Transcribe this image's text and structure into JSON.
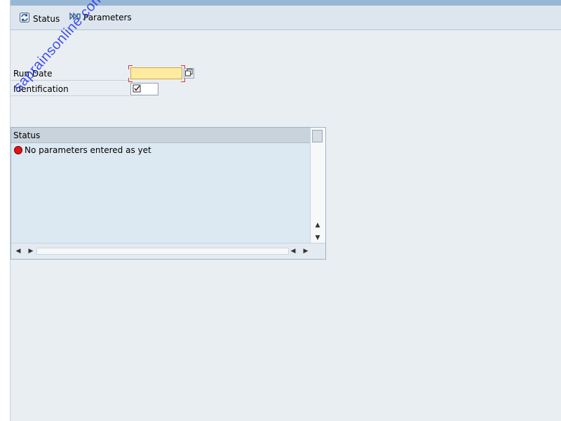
{
  "toolbar": {
    "status_label": "Status",
    "parameters_label": "Parameters",
    "status_icon": "refresh-status-icon",
    "parameters_icon": "parameters-icon"
  },
  "form": {
    "run_date_label": "Run Date",
    "run_date_value": "",
    "identification_label": "Identification",
    "identification_value": "",
    "input_help_icon": "value-help-icon"
  },
  "status_panel": {
    "header": "Status",
    "messages": [
      {
        "icon": "red-status-icon",
        "text": "No parameters entered as yet"
      }
    ]
  },
  "watermark": "saprainsonline.com",
  "colors": {
    "background": "#e9eef3",
    "toolbar": "#dde6ee",
    "required_field": "#ffeba0",
    "error_red": "#e01414",
    "watermark": "#2233ee"
  }
}
